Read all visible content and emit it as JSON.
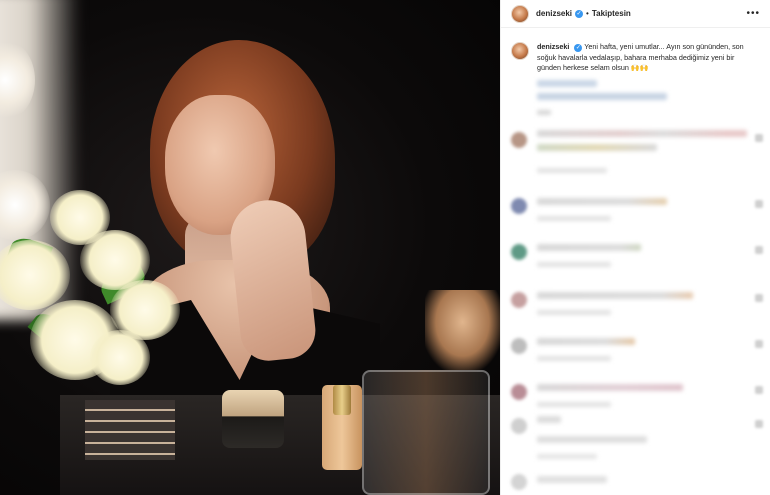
{
  "post": {
    "username": "denizseki",
    "verified": true,
    "separator": "•",
    "follow_label": "Takiptesin",
    "more_label": "•••",
    "caption": "Yeni hafta, yeni umutlar... Ayın son gününden, son soğuk havalarla vedalaşıp, bahara merhaba dediğimiz yeni bir günden herkese selam olsun 🙌🙌"
  },
  "colors": {
    "verified": "#3897f0",
    "text": "#262626",
    "divider": "#efefef"
  },
  "icons": {
    "verified": "verified-badge-icon",
    "more": "more-options-icon"
  }
}
